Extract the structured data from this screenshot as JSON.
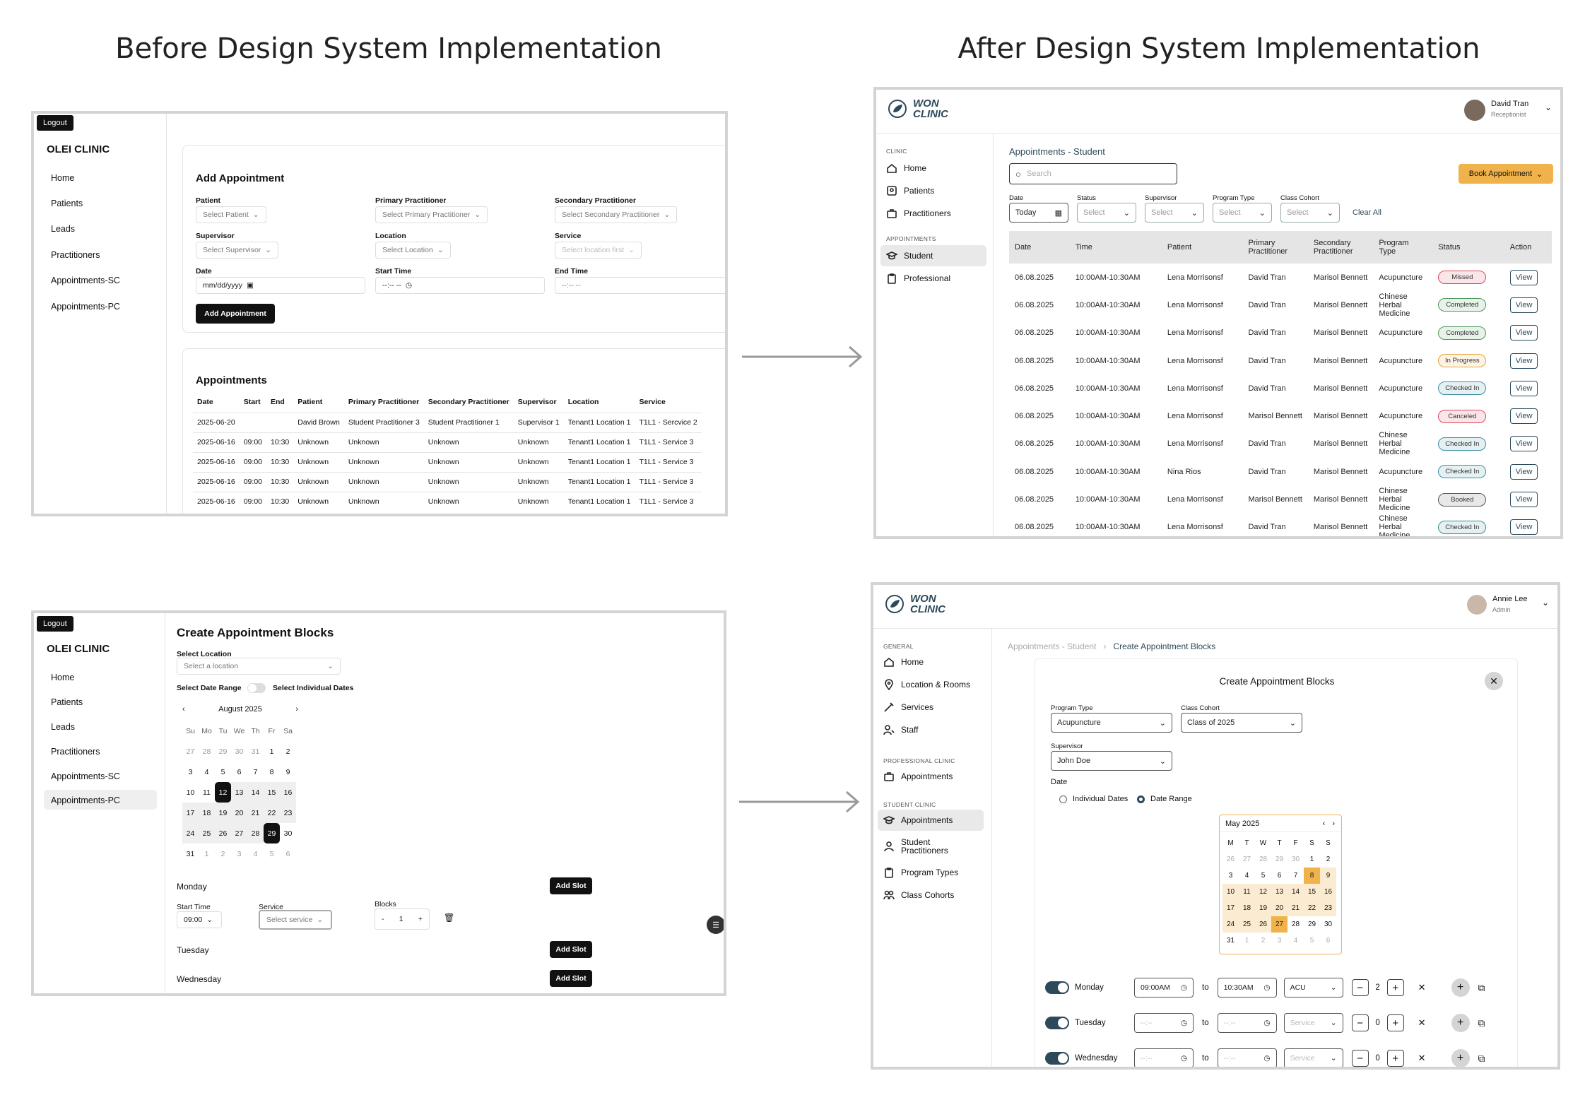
{
  "headings": {
    "before": "Before Design System Implementation",
    "after": "After Design System Implementation"
  },
  "colors": {
    "brand_teal": "#2d4a5a",
    "accent_orange": "#f0b24a",
    "old_black": "#111111"
  },
  "old_add": {
    "logout": "Logout",
    "brand": "OLEI CLINIC",
    "nav": [
      "Home",
      "Patients",
      "Leads",
      "Practitioners",
      "Appointments-SC",
      "Appointments-PC"
    ],
    "form_title": "Add Appointment",
    "labels": {
      "patient": "Patient",
      "primary": "Primary Practitioner",
      "secondary": "Secondary Practitioner",
      "supervisor": "Supervisor",
      "location": "Location",
      "service": "Service",
      "date": "Date",
      "start": "Start Time",
      "end": "End Time"
    },
    "placeholders": {
      "patient": "Select Patient",
      "primary": "Select Primary Practitioner",
      "secondary": "Select Secondary Practitioner",
      "supervisor": "Select Supervisor",
      "location": "Select Location",
      "service": "Select location first",
      "date": "mm/dd/yyyy",
      "start": "--:-- --",
      "end": "--:-- --"
    },
    "add_button": "Add Appointment",
    "list_title": "Appointments",
    "columns": [
      "Date",
      "Start",
      "End",
      "Patient",
      "Primary Practitioner",
      "Secondary Practitioner",
      "Supervisor",
      "Location",
      "Service"
    ],
    "rows": [
      [
        "2025-06-20",
        "",
        "",
        "David Brown",
        "Student Practitioner 3",
        "Student Practitioner 1",
        "Supervisor 1",
        "Tenant1 Location 1",
        "T1L1 - Sercvice 2"
      ],
      [
        "2025-06-16",
        "09:00",
        "10:30",
        "Unknown",
        "Unknown",
        "Unknown",
        "Unknown",
        "Tenant1 Location 1",
        "T1L1 - Service 3"
      ],
      [
        "2025-06-16",
        "09:00",
        "10:30",
        "Unknown",
        "Unknown",
        "Unknown",
        "Unknown",
        "Tenant1 Location 1",
        "T1L1 - Service 3"
      ],
      [
        "2025-06-16",
        "09:00",
        "10:30",
        "Unknown",
        "Unknown",
        "Unknown",
        "Unknown",
        "Tenant1 Location 1",
        "T1L1 - Service 3"
      ],
      [
        "2025-06-16",
        "09:00",
        "10:30",
        "Unknown",
        "Unknown",
        "Unknown",
        "Unknown",
        "Tenant1 Location 1",
        "T1L1 - Service 3"
      ]
    ]
  },
  "old_blocks": {
    "logout": "Logout",
    "brand": "OLEI CLINIC",
    "nav": [
      "Home",
      "Patients",
      "Leads",
      "Practitioners",
      "Appointments-SC",
      "Appointments-PC"
    ],
    "title": "Create Appointment Blocks",
    "select_location_label": "Select Location",
    "select_location_placeholder": "Select a location",
    "date_range_label": "Select Date Range",
    "individual_label": "Select Individual Dates",
    "month": "August 2025",
    "weekdays": [
      "Su",
      "Mo",
      "Tu",
      "We",
      "Th",
      "Fr",
      "Sa"
    ],
    "weeks": [
      [
        "27",
        "28",
        "29",
        "30",
        "31",
        "1",
        "2"
      ],
      [
        "3",
        "4",
        "5",
        "6",
        "7",
        "8",
        "9"
      ],
      [
        "10",
        "11",
        "12",
        "13",
        "14",
        "15",
        "16"
      ],
      [
        "17",
        "18",
        "19",
        "20",
        "21",
        "22",
        "23"
      ],
      [
        "24",
        "25",
        "26",
        "27",
        "28",
        "29",
        "30"
      ],
      [
        "31",
        "1",
        "2",
        "3",
        "4",
        "5",
        "6"
      ]
    ],
    "days": [
      "Monday",
      "Tuesday",
      "Wednesday"
    ],
    "add_slot": "Add Slot",
    "start_time_label": "Start Time",
    "start_time_value": "09:00",
    "service_label": "Service",
    "service_placeholder": "Select service",
    "blocks_label": "Blocks",
    "blocks_value": "1"
  },
  "new_list": {
    "logo_line1": "WON",
    "logo_line2": "CLINIC",
    "user_name": "David Tran",
    "user_role": "Receptionist",
    "section_clinic": "CLINIC",
    "nav_clinic": [
      "Home",
      "Patients",
      "Practitioners"
    ],
    "section_appointments": "APPOINTMENTS",
    "nav_appointments": [
      "Student",
      "Professional"
    ],
    "page_title": "Appointments - Student",
    "search_placeholder": "Search",
    "book_button": "Book Appointment",
    "filters": {
      "date_label": "Date",
      "date_value": "Today",
      "status_label": "Status",
      "supervisor_label": "Supervisor",
      "program_label": "Program Type",
      "cohort_label": "Class Cohort",
      "select": "Select",
      "clear": "Clear All"
    },
    "columns": [
      "Date",
      "Time",
      "Patient",
      "Primary Practitioner",
      "Secondary Practitioner",
      "Program Type",
      "Status",
      "Action"
    ],
    "rows": [
      [
        "06.08.2025",
        "10:00AM-10:30AM",
        "Lena Morrisonsf",
        "David Tran",
        "Marisol Bennett",
        "Acupuncture",
        "Missed"
      ],
      [
        "06.08.2025",
        "10:00AM-10:30AM",
        "Lena Morrisonsf",
        "David Tran",
        "Marisol Bennett",
        "Chinese Herbal Medicine",
        "Completed"
      ],
      [
        "06.08.2025",
        "10:00AM-10:30AM",
        "Lena Morrisonsf",
        "David Tran",
        "Marisol Bennett",
        "Acupuncture",
        "Completed"
      ],
      [
        "06.08.2025",
        "10:00AM-10:30AM",
        "Lena Morrisonsf",
        "David Tran",
        "Marisol Bennett",
        "Acupuncture",
        "In Progress"
      ],
      [
        "06.08.2025",
        "10:00AM-10:30AM",
        "Lena Morrisonsf",
        "David Tran",
        "Marisol Bennett",
        "Acupuncture",
        "Checked In"
      ],
      [
        "06.08.2025",
        "10:00AM-10:30AM",
        "Lena Morrisonsf",
        "Marisol Bennett",
        "Marisol Bennett",
        "Acupuncture",
        "Canceled"
      ],
      [
        "06.08.2025",
        "10:00AM-10:30AM",
        "Lena Morrisonsf",
        "David Tran",
        "Marisol Bennett",
        "Chinese Herbal Medicine",
        "Checked In"
      ],
      [
        "06.08.2025",
        "10:00AM-10:30AM",
        "Nina Rios",
        "David Tran",
        "Marisol Bennett",
        "Acupuncture",
        "Checked In"
      ],
      [
        "06.08.2025",
        "10:00AM-10:30AM",
        "Lena Morrisonsf",
        "Marisol Bennett",
        "Marisol Bennett",
        "Chinese Herbal Medicine",
        "Booked"
      ],
      [
        "06.08.2025",
        "10:00AM-10:30AM",
        "Lena Morrisonsf",
        "David Tran",
        "Marisol Bennett",
        "Chinese Herbal Medicine",
        "Checked In"
      ]
    ],
    "view_label": "View",
    "status_colors": {
      "Missed": "#d9455a",
      "Completed": "#4a9a57",
      "In Progress": "#e8a23a",
      "Checked In": "#3b8fa0",
      "Canceled": "#d9455a",
      "Booked": "#555555"
    }
  },
  "new_blocks": {
    "logo_line1": "WON",
    "logo_line2": "CLINIC",
    "user_name": "Annie Lee",
    "user_role": "Admin",
    "section_general": "GENERAL",
    "nav_general": [
      "Home",
      "Location & Rooms",
      "Services",
      "Staff"
    ],
    "section_professional": "PROFESSIONAL CLINIC",
    "nav_professional": [
      "Appointments"
    ],
    "section_student": "STUDENT CLINIC",
    "nav_student": [
      "Appointments",
      "Student Practitioners",
      "Program Types",
      "Class Cohorts"
    ],
    "breadcrumb_parent": "Appointments - Student",
    "breadcrumb_current": "Create Appointment Blocks",
    "modal_title": "Create Appointment Blocks",
    "program_label": "Program Type",
    "program_value": "Acupuncture",
    "cohort_label": "Class Cohort",
    "cohort_value": "Class of 2025",
    "supervisor_label": "Supervisor",
    "supervisor_value": "John Doe",
    "date_label": "Date",
    "radio_individual": "Individual Dates",
    "radio_range": "Date Range",
    "month": "May 2025",
    "weekdays": [
      "M",
      "T",
      "W",
      "T",
      "F",
      "S",
      "S"
    ],
    "weeks": [
      [
        "26",
        "27",
        "28",
        "29",
        "30",
        "1",
        "2"
      ],
      [
        "3",
        "4",
        "5",
        "6",
        "7",
        "8",
        "9"
      ],
      [
        "10",
        "11",
        "12",
        "13",
        "14",
        "15",
        "16"
      ],
      [
        "17",
        "18",
        "19",
        "20",
        "21",
        "22",
        "23"
      ],
      [
        "24",
        "25",
        "26",
        "27",
        "28",
        "29",
        "30"
      ],
      [
        "31",
        "1",
        "2",
        "3",
        "4",
        "5",
        "6"
      ]
    ],
    "slots": [
      {
        "day": "Monday",
        "start": "09:00AM",
        "end": "10:30AM",
        "service": "ACU",
        "count": "2"
      },
      {
        "day": "Tuesday",
        "start": "--:--",
        "end": "--:--",
        "service": "Service",
        "count": "0"
      },
      {
        "day": "Wednesday",
        "start": "--:--",
        "end": "--:--",
        "service": "Service",
        "count": "0"
      }
    ],
    "to_label": "to"
  }
}
